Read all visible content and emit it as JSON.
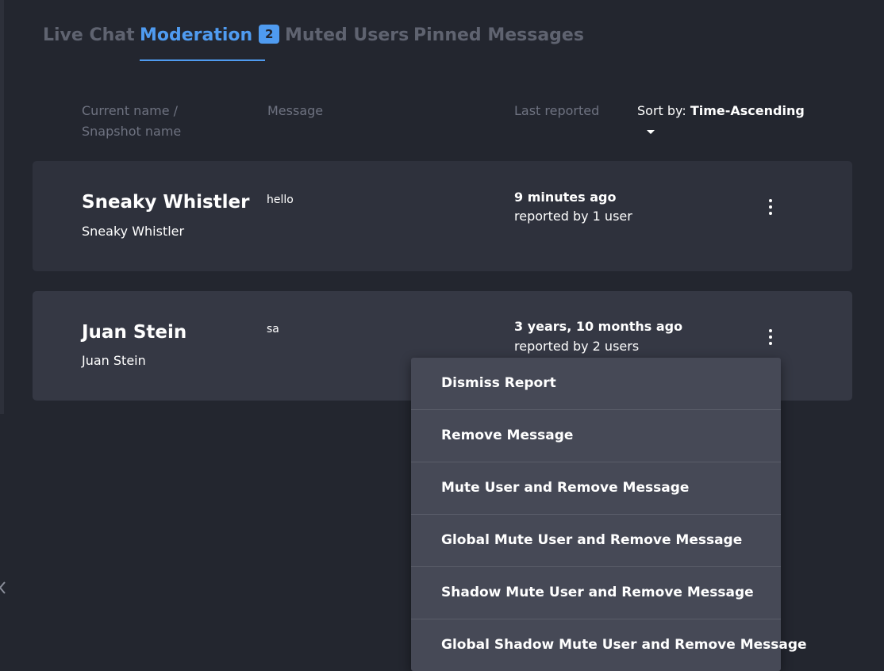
{
  "tabs": [
    {
      "label": "Live Chat",
      "active": false
    },
    {
      "label": "Moderation",
      "active": true,
      "badge": "2"
    },
    {
      "label": "Muted Users",
      "active": false
    },
    {
      "label": "Pinned Messages",
      "active": false
    }
  ],
  "columns": {
    "name": "Current name / Snapshot name",
    "message": "Message",
    "last_reported": "Last reported"
  },
  "sort": {
    "prefix": "Sort by:",
    "value": "Time-Ascending"
  },
  "reports": [
    {
      "name": "Sneaky Whistler",
      "snapshot_name": "Sneaky Whistler",
      "message": "hello",
      "time": "9 minutes ago",
      "reported_by": "reported by 1 user"
    },
    {
      "name": "Juan Stein",
      "snapshot_name": "Juan Stein",
      "message": "sa",
      "time": "3 years, 10 months ago",
      "reported_by": "reported by 2 users"
    }
  ],
  "menu": {
    "items": [
      "Dismiss Report",
      "Remove Message",
      "Mute User and Remove Message",
      "Global Mute User and Remove Message",
      "Shadow Mute User and Remove Message",
      "Global Shadow Mute User and Remove Message"
    ]
  },
  "colors": {
    "background": "#23262f",
    "card": "#2e313c",
    "card_active": "#353844",
    "accent": "#4f9bf0",
    "menu": "#464956",
    "muted_text": "#6e7280"
  }
}
